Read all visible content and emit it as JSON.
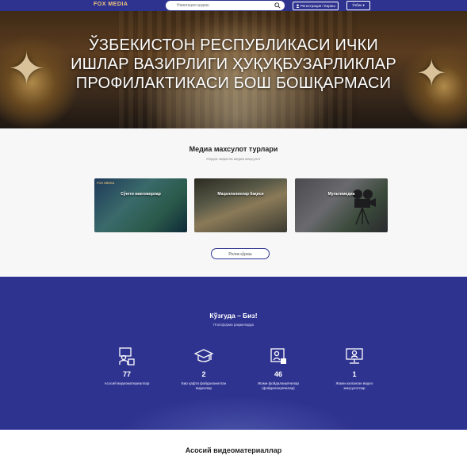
{
  "header": {
    "logo": "FOX MEDIA",
    "search_placeholder": "Навигация қидиш",
    "login_label": "Регистрация / Кириш",
    "lang_label": "Ўзбек"
  },
  "hero": {
    "title_lines": [
      "ЎЗБЕКИСТОН РЕСПУБЛИКАСИ ИЧКИ",
      "ИШЛАР ВАЗИРЛИГИ ҲУҚУҚБУЗАРЛИКЛАР",
      "ПРОФИЛАКТИКАСИ БОШ БОШҚАРМАСИ"
    ]
  },
  "media": {
    "title": "Медиа махсулот турлари",
    "subtitle": "Юқори сифатли медиа маҳсулот",
    "cards": [
      {
        "label": "Сўнгги жанговорлар",
        "brand": "FOX MEDIA"
      },
      {
        "label": "Маҳаллаликлар бақиси",
        "brand": ""
      },
      {
        "label": "Мультимедиа",
        "brand": ""
      }
    ],
    "more_label": "Ролик кўриш"
  },
  "stats": {
    "title": "Кўзгуда – Биз!",
    "subtitle": "Платформа рақамларда",
    "items": [
      {
        "icon": "video-lecture-icon",
        "value": "77",
        "label_lines": [
          "Асосий видеоматериаллар"
        ]
      },
      {
        "icon": "graduation-cap-icon",
        "value": "2",
        "label_lines": [
          "Бир ҳафта фойдаланилган",
          "видеолар"
        ]
      },
      {
        "icon": "puzzle-person-icon",
        "value": "46",
        "label_lines": [
          "Жами фойдаланувчилар",
          "(фойдаланувчилар)"
        ]
      },
      {
        "icon": "monitor-person-icon",
        "value": "1",
        "label_lines": [
          "Жами юкланган видео",
          "маҳсулотлар"
        ]
      }
    ]
  },
  "bottom": {
    "title": "Асосий видеоматериаллар"
  },
  "colors": {
    "primary": "#2f3390",
    "logo_gold": "#f0c67a"
  }
}
